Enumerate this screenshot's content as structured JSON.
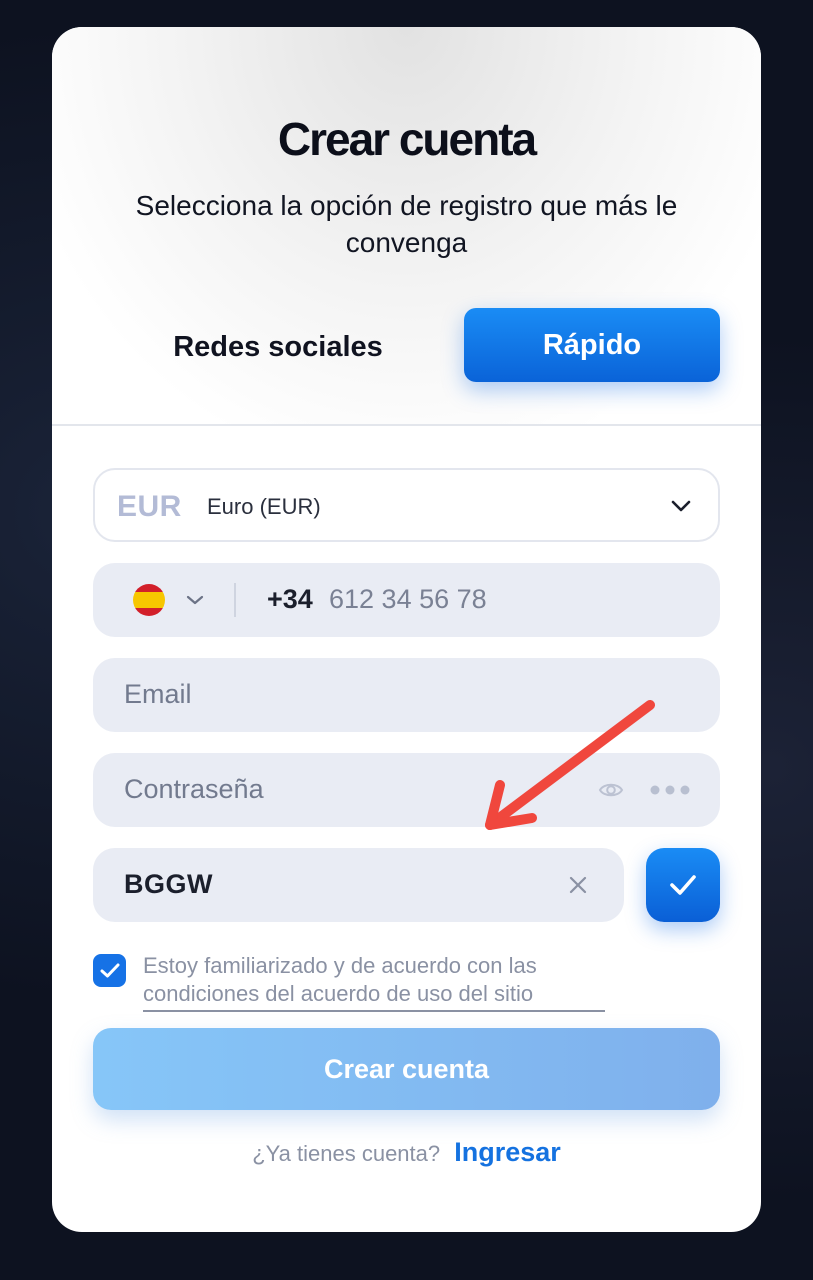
{
  "modal": {
    "title": "Crear cuenta",
    "subtitle": "Selecciona la opción de registro que más le convenga"
  },
  "tabs": {
    "social_label": "Redes sociales",
    "fast_label": "Rápido",
    "active": "Rápido"
  },
  "form": {
    "currency": {
      "code": "EUR",
      "name": "Euro (EUR)"
    },
    "phone": {
      "country_flag": "spain-flag-icon",
      "prefix": "+34",
      "placeholder": "612 34 56 78"
    },
    "email": {
      "placeholder": "Email"
    },
    "password": {
      "placeholder": "Contraseña"
    },
    "promo_code": {
      "value": "BGGW"
    },
    "terms": {
      "checked": true,
      "text": "Estoy familiarizado y de acuerdo con las",
      "link": "condiciones del acuerdo de uso del sitio"
    },
    "submit_label": "Crear cuenta"
  },
  "footer": {
    "question": "¿Ya tienes cuenta?",
    "login_label": "Ingresar"
  },
  "colors": {
    "accent": "#0a63d8",
    "submit_disabled": "#86c6f8",
    "annotation_arrow": "#f0473d"
  }
}
